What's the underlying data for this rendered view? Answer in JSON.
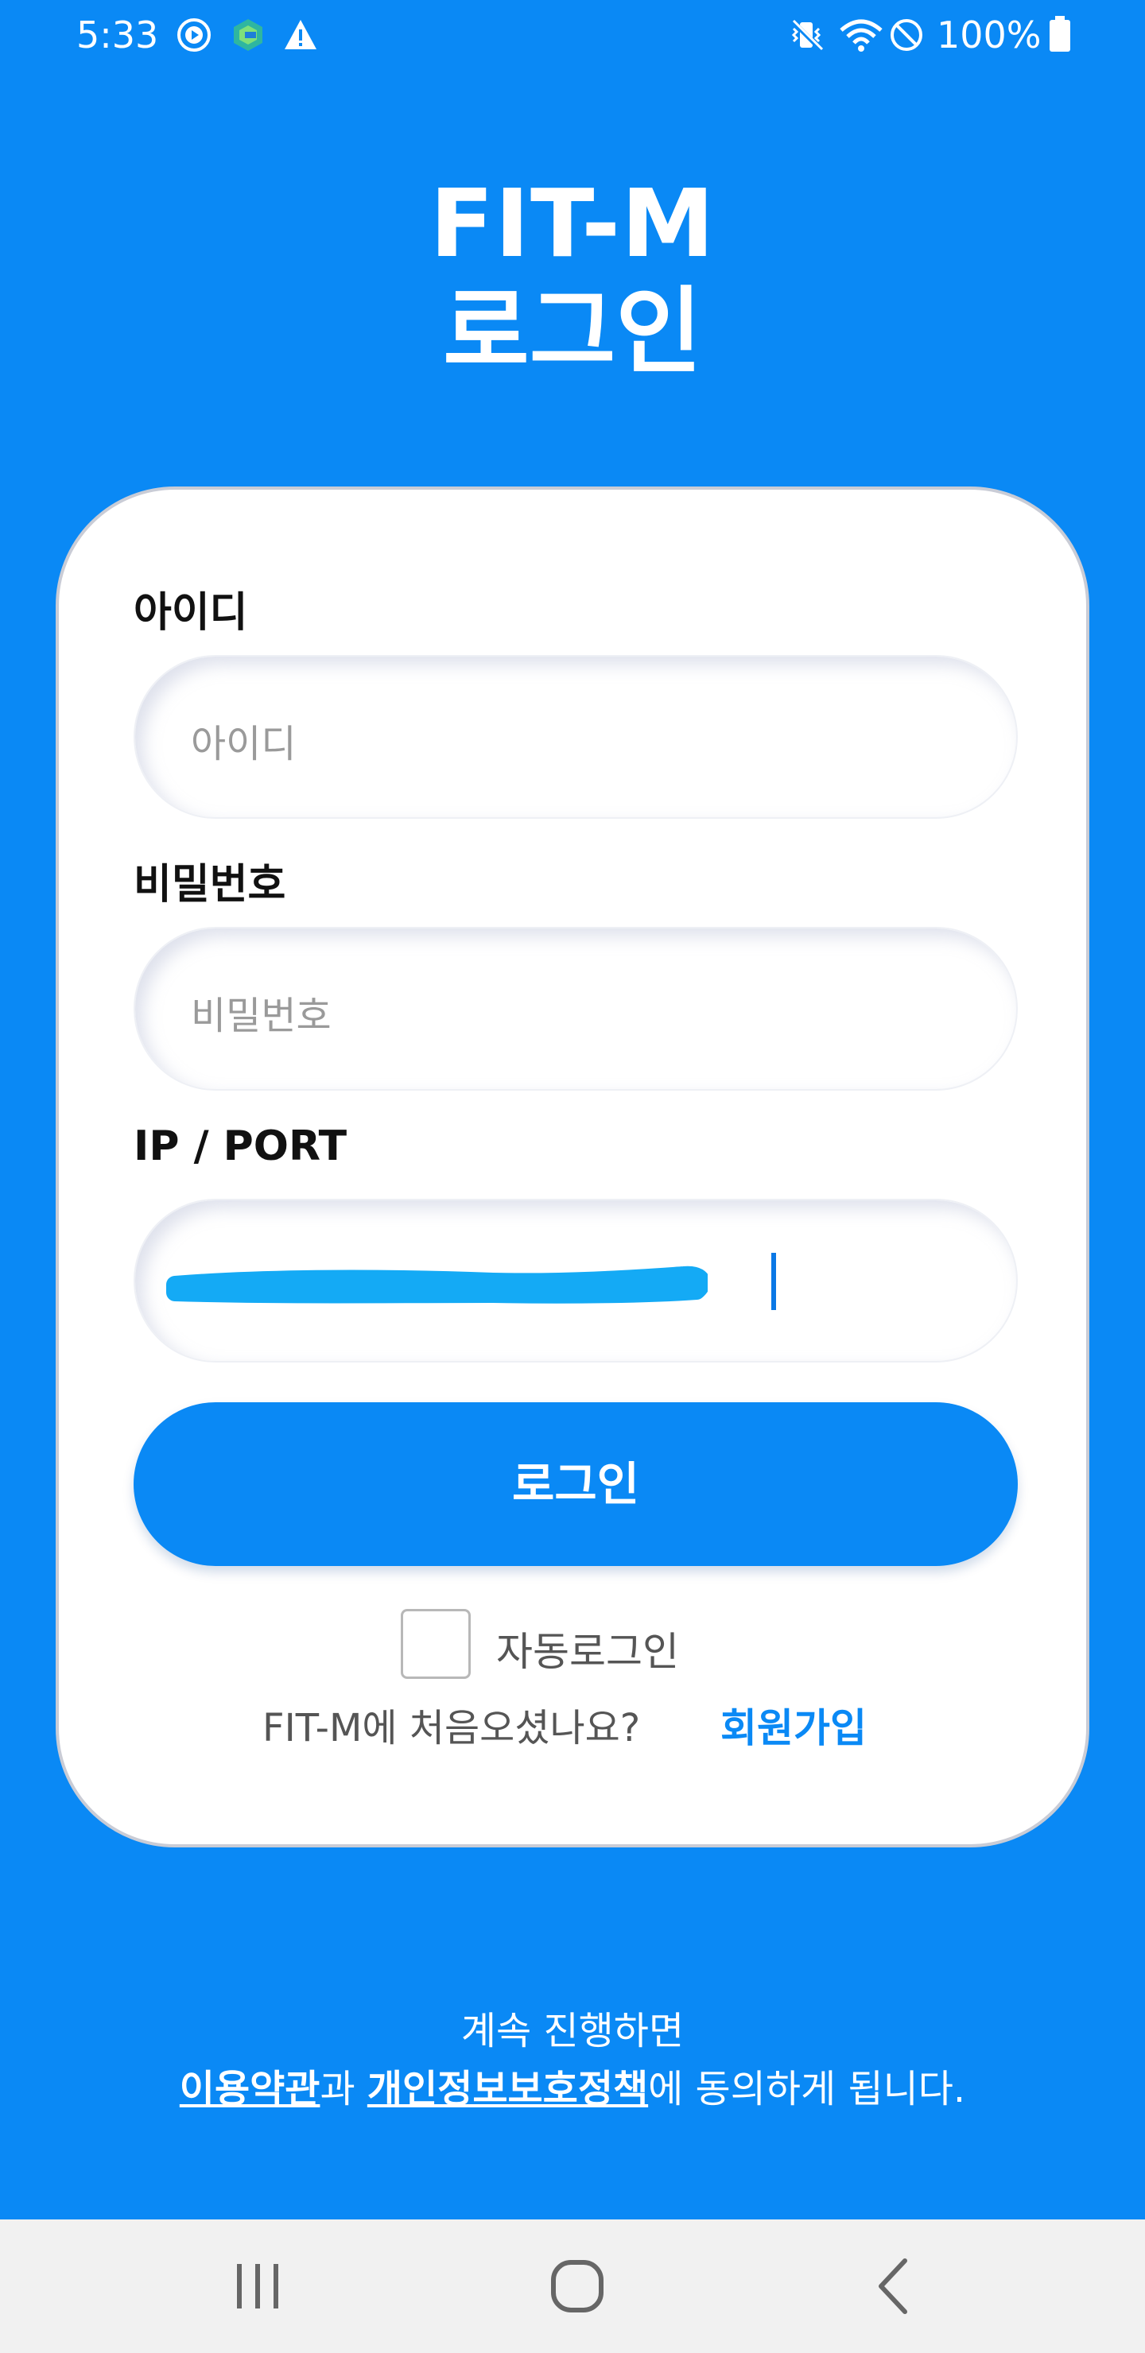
{
  "status_bar": {
    "time": "5:33",
    "battery": "100%",
    "icons": [
      "media-icon",
      "app-icon",
      "warning-icon",
      "vibrate-icon",
      "wifi-icon",
      "dnd-icon",
      "battery-icon"
    ]
  },
  "header": {
    "brand": "FIT-M",
    "subtitle": "로그인"
  },
  "form": {
    "id_label": "아이디",
    "id_placeholder": "아이디",
    "password_label": "비밀번호",
    "password_placeholder": "비밀번호",
    "ip_label": "IP / PORT",
    "ip_value_redacted": true,
    "login_button": "로그인",
    "auto_login_label": "자동로그인",
    "auto_login_checked": false,
    "signup_prompt": "FIT-M에 처음오셨나요?",
    "signup_link": "회원가입"
  },
  "footer": {
    "line1": "계속 진행하면",
    "terms_link": "이용약관",
    "conj": "과 ",
    "privacy_link": "개인정보보호정책",
    "suffix": "에 동의하게 됩니다."
  },
  "nav_bar": {
    "buttons": [
      "recent-apps-icon",
      "home-icon",
      "back-icon"
    ]
  },
  "colors": {
    "primary": "#0a89f5",
    "card": "#ffffff",
    "navbar": "#f1f1f1",
    "redaction": "#14aaf5"
  }
}
